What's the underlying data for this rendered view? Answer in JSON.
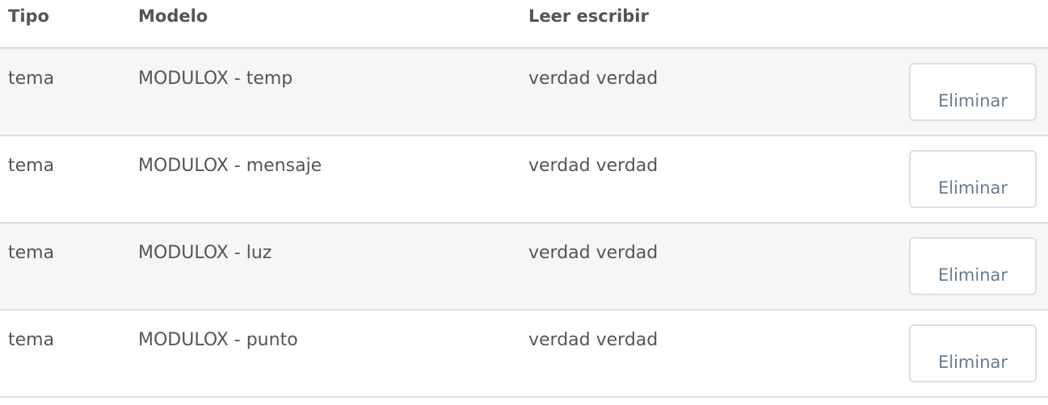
{
  "table": {
    "headers": {
      "type": "Tipo",
      "model": "Modelo",
      "read_write": "Leer escribir"
    },
    "rows": [
      {
        "type": "tema",
        "model": "MODULOX - temp",
        "read_write": "verdad verdad",
        "action": "Eliminar"
      },
      {
        "type": "tema",
        "model": "MODULOX - mensaje",
        "read_write": "verdad verdad",
        "action": "Eliminar"
      },
      {
        "type": "tema",
        "model": "MODULOX - luz",
        "read_write": "verdad verdad",
        "action": "Eliminar"
      },
      {
        "type": "tema",
        "model": "MODULOX - punto",
        "read_write": "verdad verdad",
        "action": "Eliminar"
      }
    ]
  },
  "colors": {
    "stripe": "#f6f6f6",
    "border": "#dddddd",
    "button_text": "#6a7a8e",
    "button_border": "#d9dfe8"
  }
}
